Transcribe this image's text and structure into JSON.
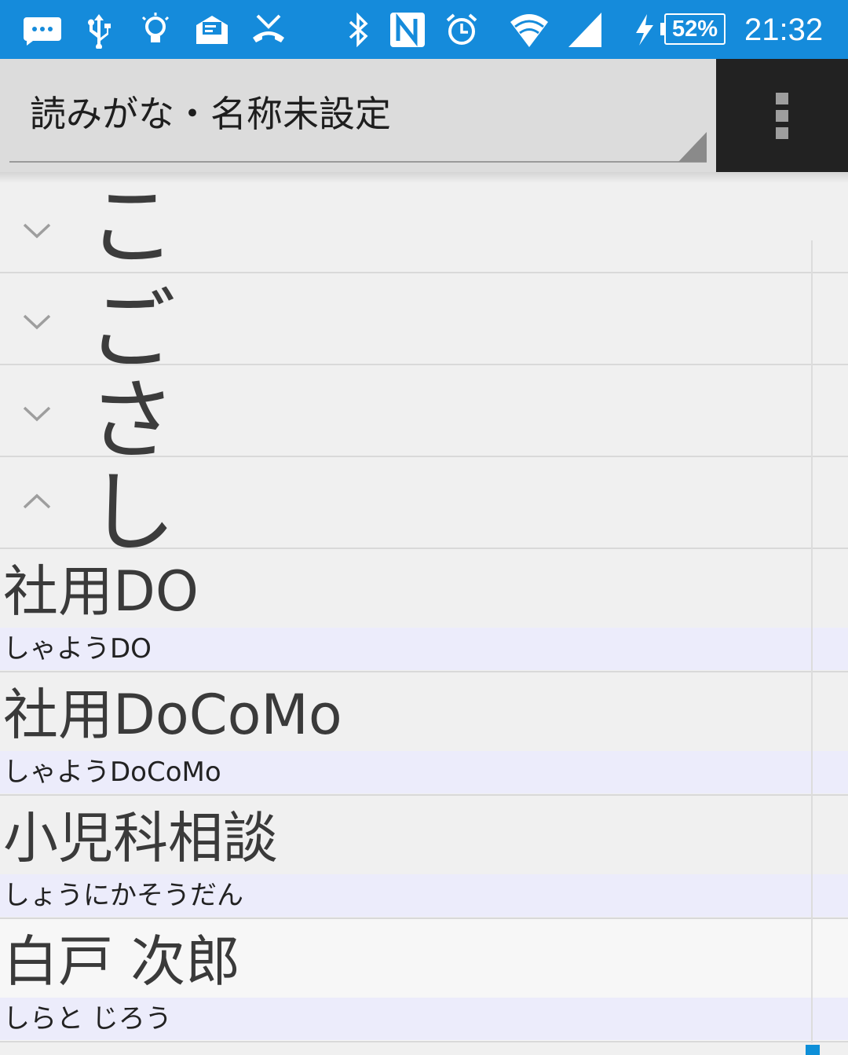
{
  "status_bar": {
    "battery": "52%",
    "time": "21:32",
    "bg_color": "#158bdb",
    "icons": [
      "chat-icon",
      "usb-icon",
      "lightbulb-icon",
      "mail-icon",
      "missed-call-icon",
      "bluetooth-icon",
      "nfc-icon",
      "alarm-icon",
      "wifi-icon",
      "signal-icon",
      "charging-icon"
    ]
  },
  "action_bar": {
    "title": "読みがな・名称未設定",
    "overflow_icon": "more-vert-icon"
  },
  "sections": [
    {
      "kana": "",
      "expanded": false
    },
    {
      "kana": "こ",
      "expanded": false
    },
    {
      "kana": "ご",
      "expanded": false
    },
    {
      "kana": "さ",
      "expanded": false
    },
    {
      "kana": "し",
      "expanded": true
    }
  ],
  "contacts": [
    {
      "name": "社用DO",
      "reading": "しゃようDO"
    },
    {
      "name": "社用DoCoMo",
      "reading": "しゃようDoCoMo"
    },
    {
      "name": "小児科相談",
      "reading": "しょうにかそうだん"
    },
    {
      "name": "白戸 次郎",
      "reading": "しらと じろう"
    }
  ],
  "colors": {
    "reading_bg": "#ececfb",
    "scroll_thumb": "#0e8fd8"
  }
}
